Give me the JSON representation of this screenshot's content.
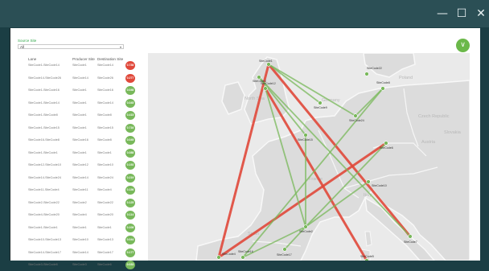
{
  "window": {
    "minimize_glyph": "—",
    "maximize_glyph": "☐",
    "close_glyph": "✕"
  },
  "filter": {
    "label": "Source Site",
    "value": "All",
    "caret": "▾"
  },
  "export_icon": "arrow-down-icon",
  "export_glyph": "∨",
  "colors": {
    "high": "#e0483a",
    "low": "#78b85a",
    "brand": "#6bb84a"
  },
  "table": {
    "headers": {
      "lane": "Lane",
      "producer": "Producer Site",
      "destination": "Destination Site"
    },
    "rows": [
      {
        "lane": "SiteCode1-SiteCode14",
        "producer": "SiteCode1",
        "destination": "SiteCode14",
        "value": "0.736",
        "level": "high"
      },
      {
        "lane": "SiteCode14-SiteCode26",
        "producer": "SiteCode14",
        "destination": "SiteCode26",
        "value": "0.277",
        "level": "high"
      },
      {
        "lane": "SiteCode1-SiteCode16",
        "producer": "SiteCode1",
        "destination": "SiteCode16",
        "value": "0.046",
        "level": "low"
      },
      {
        "lane": "SiteCode1-SiteCode14",
        "producer": "SiteCode1",
        "destination": "SiteCode14",
        "value": "0.045",
        "level": "low"
      },
      {
        "lane": "SiteCode1-SiteCode8",
        "producer": "SiteCode1",
        "destination": "SiteCode8",
        "value": "0.415",
        "level": "low"
      },
      {
        "lane": "SiteCode1-SiteCode15",
        "producer": "SiteCode1",
        "destination": "SiteCode15",
        "value": "0.716",
        "level": "low"
      },
      {
        "lane": "SiteCode16-SiteCode8",
        "producer": "SiteCode16",
        "destination": "SiteCode8",
        "value": "0.049",
        "level": "low"
      },
      {
        "lane": "SiteCode1-SiteCode1",
        "producer": "SiteCode1",
        "destination": "SiteCode1",
        "value": "0.088",
        "level": "low"
      },
      {
        "lane": "SiteCode12-SiteCode10",
        "producer": "SiteCode12",
        "destination": "SiteCode10",
        "value": "0.192",
        "level": "low"
      },
      {
        "lane": "SiteCode14-SiteCode24",
        "producer": "SiteCode14",
        "destination": "SiteCode24",
        "value": "0.219",
        "level": "low"
      },
      {
        "lane": "SiteCode11-SiteCode4",
        "producer": "SiteCode11",
        "destination": "SiteCode4",
        "value": "0.156",
        "level": "low"
      },
      {
        "lane": "SiteCode2-SiteCode22",
        "producer": "SiteCode2",
        "destination": "SiteCode22",
        "value": "0.125",
        "level": "low"
      },
      {
        "lane": "SiteCode4-SiteCode20",
        "producer": "SiteCode4",
        "destination": "SiteCode20",
        "value": "0.114",
        "level": "low"
      },
      {
        "lane": "SiteCode1-SiteCode1",
        "producer": "SiteCode1",
        "destination": "SiteCode1",
        "value": "0.108",
        "level": "low"
      },
      {
        "lane": "SiteCode10-SiteCode13",
        "producer": "SiteCode10",
        "destination": "SiteCode13",
        "value": "0.044",
        "level": "low"
      },
      {
        "lane": "SiteCode14-SiteCode17",
        "producer": "SiteCode14",
        "destination": "SiteCode17",
        "value": "0.177",
        "level": "low"
      },
      {
        "lane": "SiteCode3-SiteCode6",
        "producer": "SiteCode3",
        "destination": "SiteCode6",
        "value": "0.033",
        "level": "low"
      }
    ]
  },
  "map": {
    "place_labels": [
      "North Sea",
      "Germany",
      "France",
      "Italy",
      "Poland",
      "Czech Republic",
      "Austria",
      "Slovakia",
      "Spain"
    ],
    "sites": [
      {
        "label": "SiteCode1"
      },
      {
        "label": "SiteCode3"
      },
      {
        "label": "SiteCode12"
      },
      {
        "label": "SiteCode22"
      },
      {
        "label": "SiteCode8"
      },
      {
        "label": "SiteCode9"
      },
      {
        "label": "SiteCode24"
      },
      {
        "label": "SiteCode15"
      },
      {
        "label": "SiteCode6"
      },
      {
        "label": "SiteCode10"
      },
      {
        "label": "SiteCode2"
      },
      {
        "label": "SiteCode7"
      },
      {
        "label": "SiteCode4"
      },
      {
        "label": "SiteCode17"
      },
      {
        "label": "SiteCode16"
      },
      {
        "label": "SiteCode5"
      }
    ],
    "routes": [
      {
        "from": "SiteCode1",
        "to": "SiteCode4",
        "level": "high"
      },
      {
        "from": "SiteCode12",
        "to": "SiteCode5",
        "level": "high"
      },
      {
        "from": "SiteCode1",
        "to": "SiteCode7",
        "level": "high"
      },
      {
        "from": "SiteCode6",
        "to": "SiteCode4",
        "level": "high"
      },
      {
        "from": "SiteCode1",
        "to": "SiteCode9",
        "level": "low"
      },
      {
        "from": "SiteCode12",
        "to": "SiteCode2",
        "level": "low"
      },
      {
        "from": "SiteCode3",
        "to": "SiteCode15",
        "level": "low"
      },
      {
        "from": "SiteCode16",
        "to": "SiteCode2",
        "level": "low"
      },
      {
        "from": "SiteCode10",
        "to": "SiteCode2",
        "level": "low"
      },
      {
        "from": "SiteCode15",
        "to": "SiteCode2",
        "level": "low"
      },
      {
        "from": "SiteCode2",
        "to": "SiteCode17",
        "level": "low"
      },
      {
        "from": "SiteCode16",
        "to": "SiteCode8",
        "level": "low"
      },
      {
        "from": "SiteCode6",
        "to": "SiteCode2",
        "level": "low"
      },
      {
        "from": "SiteCode3",
        "to": "SiteCode7",
        "level": "low"
      },
      {
        "from": "SiteCode1",
        "to": "SiteCode24",
        "level": "low"
      },
      {
        "from": "SiteCode8",
        "to": "SiteCode24",
        "level": "low"
      }
    ]
  }
}
